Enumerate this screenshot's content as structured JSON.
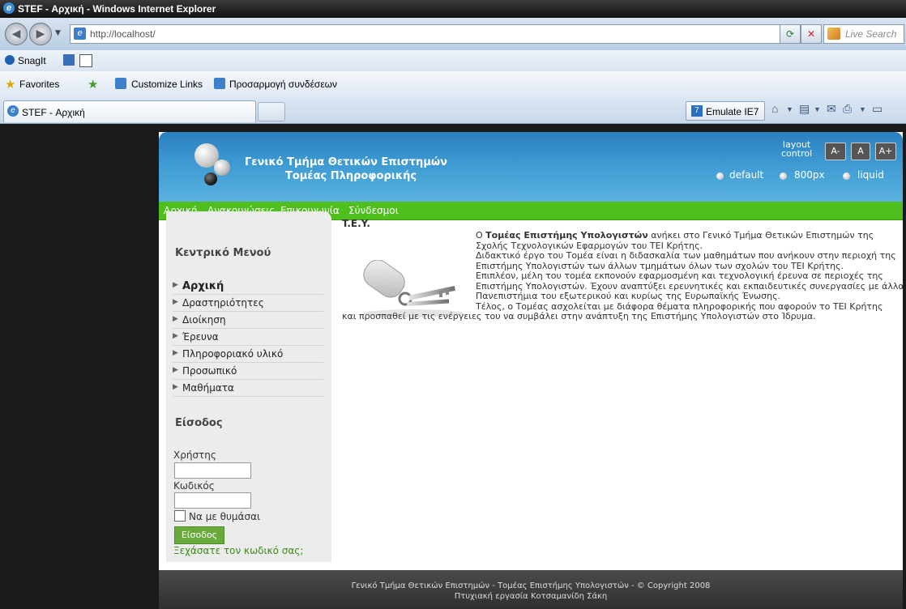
{
  "window": {
    "title": "STEF - Αρχική - Windows Internet Explorer"
  },
  "browser": {
    "url": "http://localhost/",
    "search_placeholder": "Live Search",
    "toolbar1": {
      "snagit": "SnagIt"
    },
    "toolbar2": {
      "favorites": "Favorites",
      "customize_links": "Customize Links",
      "greek_links": "Προσαρμογή συνδέσεων"
    },
    "tab": {
      "label": "STEF - Αρχική"
    },
    "emulate": "Emulate IE7"
  },
  "site": {
    "title_line1": "Γενικό Τμήμα Θετικών Επιστημών",
    "title_line2": "Τομέας Πληροφορικής",
    "layout_control_line1": "layout",
    "layout_control_line2": "control",
    "font_buttons": [
      "A-",
      "A",
      "A+"
    ],
    "layout_options": [
      "default",
      "800px",
      "liquid"
    ],
    "nav": [
      "Αρχική",
      "Ανακοινώσεις",
      "Επικοινωνία",
      "Σύνδεσμοι"
    ],
    "sidebar": {
      "menu_title": "Κεντρικό Μενού",
      "menu": [
        "Αρχική",
        "Δραστηριότητες",
        "Διοίκηση",
        "Έρευνα",
        "Πληροφοριακό υλικό",
        "Προσωπικό",
        "Μαθήματα"
      ],
      "login_title": "Είσοδος",
      "username_label": "Χρήστης",
      "password_label": "Κωδικός",
      "remember_label": "Να με θυμάσαι",
      "login_button": "Είσοδος",
      "forgot_link": "Ξεχάσατε τον κωδικό σας;"
    },
    "content": {
      "heading": "T.E.Y.",
      "p1_pre": "Ο ",
      "p1_bold": "Τομέας Επιστήμης Υπολογιστών",
      "p1_post": " ανήκει στο Γενικό Τμήμα Θετικών Επιστημών της",
      "lines": [
        "Σχολής Τεχνολογικών Εφαρμογών του ΤΕΙ Κρήτης.",
        "Διδακτικό έργο του Τομέα είναι η διδασκαλία των μαθημάτων που ανήκουν στην περιοχή της",
        "Επιστήμης Υπολογιστών των άλλων τμημάτων όλων των σχολών του ΤΕΙ Κρήτης.",
        "Επιπλέον, μέλη του τομέα εκπονούν εφαρμοσμένη και τεχνολογική έρευνα σε περιοχές της",
        "Επιστήμης Υπολογιστών. Έχουν αναπτύξει ερευνητικές και εκπαιδευτικές συνεργασίες με άλλα",
        "Πανεπιστήμια του εξωτερικού και κυρίως της Ευρωπαϊκής Ένωσης.",
        "Τέλος, ο Τομέας ασχολείται με διάφορα θέματα πληροφορικής που αφορούν το ΤΕΙ Κρήτης"
      ],
      "last_line": "και προσπαθεί με τις ενέργειες του να συμβάλει στην ανάπτυξη της Επιστήμης Υπολογιστών στο Ίδρυμα."
    },
    "footer": {
      "line1": "Γενικό Τμήμα Θετικών Επιστημών - Τομέας Επιστήμης Υπολογιστών - © Copyright 2008",
      "line2": "Πτυχιακή εργασία Κοτσαμανίδη Σάκη"
    }
  }
}
